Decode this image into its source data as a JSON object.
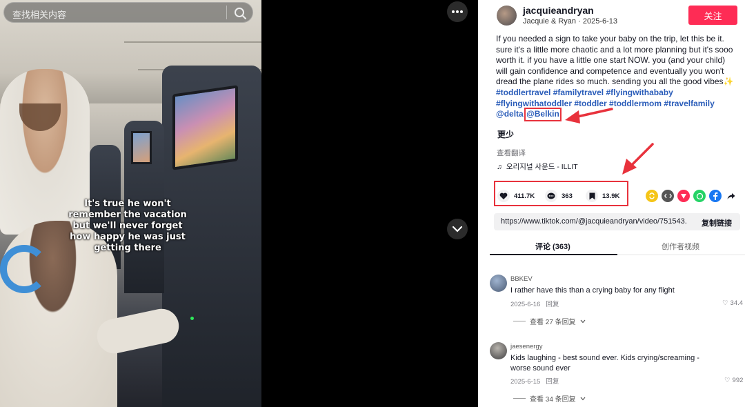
{
  "search": {
    "placeholder": "查找相关内容"
  },
  "video": {
    "caption": "It's true he won't remember the vacation but we'll never forget how happy he was just getting there"
  },
  "author": {
    "username": "jacquieandryan",
    "display_name": "Jacquie & Ryan",
    "date": "2025-6-13",
    "follow_label": "关注"
  },
  "description": {
    "text": "If you needed a sign to take your baby on the trip, let this be it. sure it's a little more chaotic and a lot more planning but it's sooo worth it. if you have a little one start NOW. you (and your child) will gain confidence and competence and eventually you won't dread the plane rides so much. sending you all the good vibes✨ ",
    "hashtags": [
      "#toddlertravel",
      "#familytravel",
      "#flyingwithababy",
      "#flyingwithatoddler",
      "#toddler",
      "#toddlermom",
      "#travelfamily"
    ],
    "mention_delta": "@delta",
    "mention_belkin": "@Belkin",
    "less_label": "更少",
    "translate_label": "查看翻译",
    "music": "오리지널 사운드 - ILLIT"
  },
  "actions": {
    "likes": "411.7K",
    "comments": "363",
    "saves": "13.9K"
  },
  "share": {
    "link": "https://www.tiktok.com/@jacquieandryan/video/751543...",
    "copy_label": "复制链接"
  },
  "tabs": {
    "comments": "评论 (363)",
    "creator_videos": "创作者视频"
  },
  "comments": [
    {
      "user": "BBKEV",
      "text": "I rather have this than a crying baby for any flight",
      "date": "2025-6-16",
      "reply_label": "回复",
      "likes": "34.4",
      "view_replies": "查看 27 条回复"
    },
    {
      "user": "jaesenergy",
      "text": "Kids laughing - best sound ever. Kids crying/screaming - worse sound ever",
      "date": "2025-6-15",
      "reply_label": "回复",
      "likes": "992",
      "view_replies": "查看 34 条回复"
    }
  ],
  "colors": {
    "follow": "#fe2c55",
    "hashtag": "#2b5db9",
    "annotation": "#e8323c"
  }
}
